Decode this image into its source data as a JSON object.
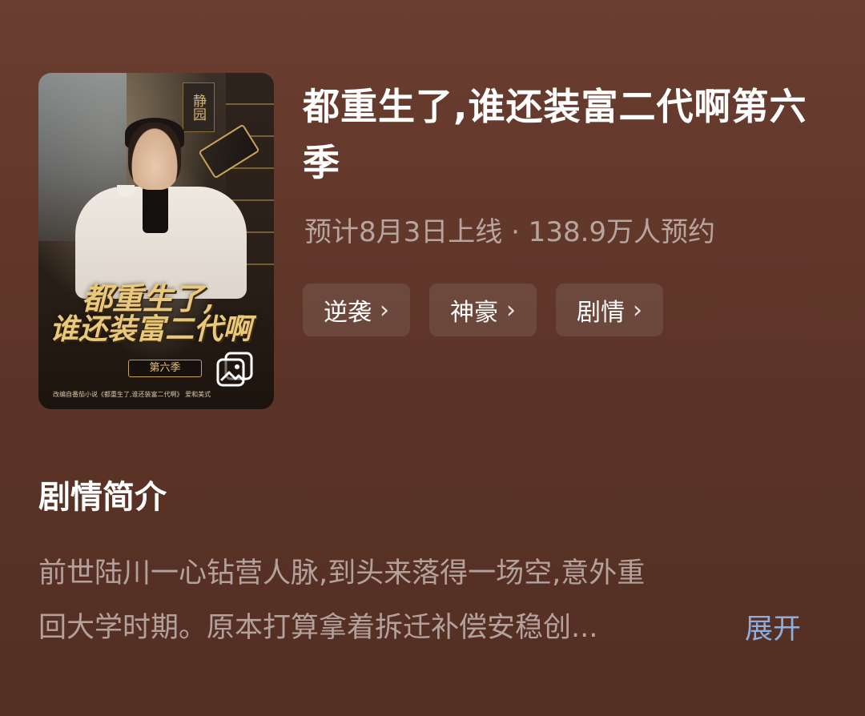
{
  "poster": {
    "seal_text": "静园",
    "title_line1": "都重生了,",
    "title_line2": "谁还装富二代啊",
    "season": "第六季",
    "credit": "改编自番茄小说《都重生了,谁还装富二代啊》 爱和美式",
    "icon": "gallery-icon"
  },
  "show": {
    "title": "都重生了,谁还装富二代啊第六季",
    "meta": "预计8月3日上线 · 138.9万人预约",
    "tags": [
      {
        "label": "逆袭",
        "icon": "chevron-right-icon"
      },
      {
        "label": "神豪",
        "icon": "chevron-right-icon"
      },
      {
        "label": "剧情",
        "icon": "chevron-right-icon"
      }
    ]
  },
  "synopsis": {
    "heading": "剧情简介",
    "line1": "前世陆川一心钻营人脉,到头来落得一场空,意外重",
    "line2": "回大学时期。原本打算拿着拆迁补偿安稳创...",
    "expand_label": "展开"
  },
  "colors": {
    "background": "#5e3528",
    "link": "#8faedc"
  }
}
